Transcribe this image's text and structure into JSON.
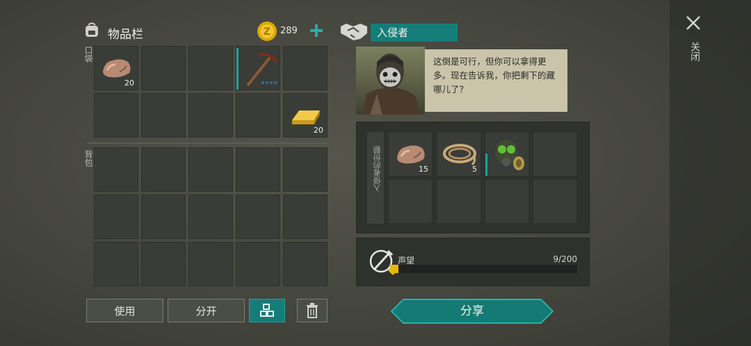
{
  "inventory": {
    "title": "物品栏",
    "coins": "289",
    "pocket_label": "口袋",
    "backpack_label": "背包",
    "pocket_items": [
      {
        "name": "stone",
        "qty": "20"
      },
      {
        "name": "pickaxe",
        "qty": ""
      },
      {
        "name": "gold-bar",
        "qty": "20"
      }
    ]
  },
  "actions": {
    "use_label": "使用",
    "split_label": "分开",
    "share_label": "分享"
  },
  "dialog": {
    "npc_name": "入侵者",
    "speech": "这倒是可行，但你可以拿得更多。现在告诉我，你把剩下的藏哪儿了？",
    "share_panel_label": "入侵者的份额",
    "share_items": [
      {
        "name": "stone",
        "qty": "15"
      },
      {
        "name": "rope",
        "qty": "5"
      },
      {
        "name": "gas-mask",
        "qty": ""
      }
    ]
  },
  "reputation": {
    "label": "声望",
    "value": "9/200",
    "progress": 0.045
  },
  "close": {
    "label": "关闭"
  },
  "colors": {
    "accent_teal": "#157d78",
    "gold": "#e6b800"
  }
}
